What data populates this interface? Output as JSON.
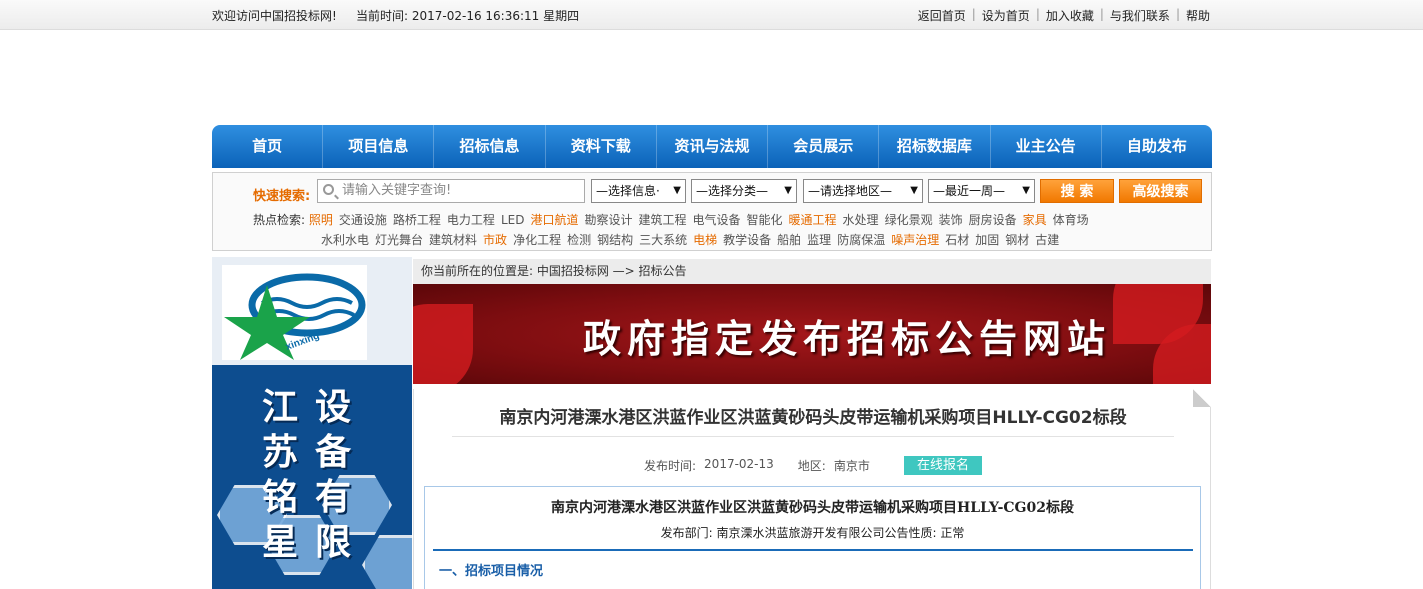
{
  "topbar": {
    "welcome": "欢迎访问中国招投标网!",
    "clock": "当前时间: 2017-02-16 16:36:11  星期四",
    "links": [
      "返回首页",
      "设为首页",
      "加入收藏",
      "与我们联系",
      "帮助"
    ]
  },
  "nav": [
    "首页",
    "项目信息",
    "招标信息",
    "资料下载",
    "资讯与法规",
    "会员展示",
    "招标数据库",
    "业主公告",
    "自助发布"
  ],
  "search": {
    "label": "快速搜索:",
    "placeholder": "请输入关键字查询!",
    "select_info": "—选择信息·",
    "select_category": "—选择分类—",
    "select_region": "—请选择地区—",
    "select_time": "—最近一周—",
    "search_button": "搜 索",
    "advanced_button": "高级搜索"
  },
  "hot": {
    "label": "热点检索:",
    "row1": [
      {
        "t": "照明",
        "o": true
      },
      {
        "t": "交通设施"
      },
      {
        "t": "路桥工程"
      },
      {
        "t": "电力工程"
      },
      {
        "t": "LED"
      },
      {
        "t": "港口航道",
        "o": true
      },
      {
        "t": "勘察设计"
      },
      {
        "t": "建筑工程"
      },
      {
        "t": "电气设备"
      },
      {
        "t": "智能化"
      },
      {
        "t": "暖通工程",
        "o": true
      },
      {
        "t": "水处理"
      },
      {
        "t": "绿化景观"
      },
      {
        "t": "装饰"
      },
      {
        "t": "厨房设备"
      },
      {
        "t": "家具",
        "o": true
      },
      {
        "t": "体育场"
      }
    ],
    "row2": [
      {
        "t": "水利水电"
      },
      {
        "t": "灯光舞台"
      },
      {
        "t": "建筑材料"
      },
      {
        "t": "市政",
        "o": true
      },
      {
        "t": "净化工程"
      },
      {
        "t": "检测"
      },
      {
        "t": "钢结构"
      },
      {
        "t": "三大系统"
      },
      {
        "t": "电梯",
        "o": true
      },
      {
        "t": "教学设备"
      },
      {
        "t": "船舶"
      },
      {
        "t": "监理"
      },
      {
        "t": "防腐保温"
      },
      {
        "t": "噪声治理",
        "o": true
      },
      {
        "t": "石材"
      },
      {
        "t": "加固"
      },
      {
        "t": "钢材"
      },
      {
        "t": "古建"
      }
    ]
  },
  "left": {
    "logo_text": "xinxing",
    "ad_col1": [
      "江",
      "苏",
      "铭",
      "星"
    ],
    "ad_col2": [
      "设",
      "备",
      "有",
      "限"
    ]
  },
  "breadcrumb": "你当前所在的位置是: 中国招投标网 —> 招标公告",
  "banner_text": "政府指定发布招标公告网站",
  "article": {
    "title": "南京内河港溧水港区洪蓝作业区洪蓝黄砂码头皮带运输机采购项目HLLY-CG02标段",
    "date_label": "发布时间:",
    "date": "2017-02-13",
    "region_label": "地区:",
    "region": "南京市",
    "register_button": "在线报名",
    "inner_title": "南京内河港溧水港区洪蓝作业区洪蓝黄砂码头皮带运输机采购项目HLLY-CG02标段",
    "inner_dept": "发布部门: 南京溧水洪蓝旅游开发有限公司公告性质:  正常",
    "section1": "一、招标项目情况"
  },
  "colors": {
    "nav_blue": "#0b62b8",
    "accent_orange": "#f17800",
    "banner_red": "#7d0d10",
    "register_teal": "#3fc7c0"
  }
}
